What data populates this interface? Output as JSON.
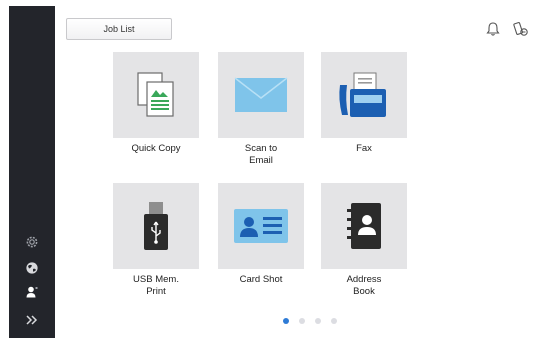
{
  "header": {
    "job_list_label": "Job List"
  },
  "functions": [
    {
      "label": "Quick Copy",
      "icon": "copy-document-icon"
    },
    {
      "label": "Scan to\nEmail",
      "icon": "envelope-icon"
    },
    {
      "label": "Fax",
      "icon": "fax-machine-icon"
    },
    {
      "label": "USB Mem.\nPrint",
      "icon": "usb-drive-icon"
    },
    {
      "label": "Card Shot",
      "icon": "id-card-icon"
    },
    {
      "label": "Address\nBook",
      "icon": "address-book-icon"
    }
  ],
  "pagination": {
    "pages": 4,
    "active_page": 1
  },
  "colors": {
    "sidebar": "#23252b",
    "tile": "#e4e4e6",
    "accent_blue": "#2e7bd6",
    "light_blue": "#7fc4ea"
  },
  "sidebar_icons": [
    "settings-icon",
    "language-globe-icon",
    "user-icon",
    "expand-chevron-icon"
  ],
  "top_right_icons": [
    "notification-bell-icon",
    "toner-status-icon"
  ]
}
